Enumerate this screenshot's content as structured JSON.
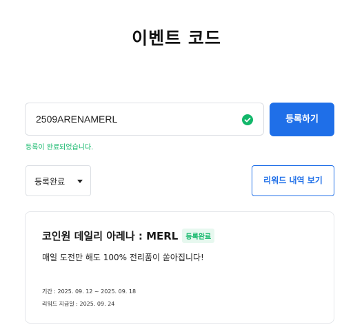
{
  "page": {
    "title": "이벤트 코드"
  },
  "code_form": {
    "input_value": "2509ARENAMERL",
    "register_label": "등록하기",
    "success_message": "등록이 완료되었습니다.",
    "success_color": "#12b76a",
    "accent_color": "#1f6fe8"
  },
  "filters": {
    "status_selected": "등록완료",
    "history_button_label": "리워드 내역 보기"
  },
  "events": [
    {
      "title": "코인원 데일리 아레나 : MERL",
      "badge": "등록완료",
      "description": "매일 도전만 해도 100% 전리품이 쏟아집니다!",
      "period": "기간 : 2025. 09. 12 ~ 2025. 09. 18",
      "reward_date": "리워드 지급일 : 2025. 09. 24"
    }
  ]
}
